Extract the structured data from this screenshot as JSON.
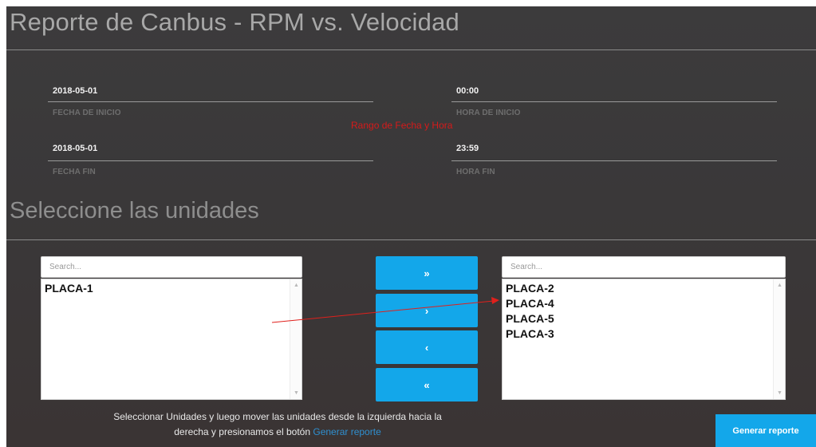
{
  "header": {
    "title": "Reporte de Canbus - RPM vs. Velocidad"
  },
  "date_range": {
    "start_date": {
      "value": "2018-05-01",
      "label": "FECHA DE INICIO"
    },
    "start_time": {
      "value": "00:00",
      "label": "HORA DE INICIO"
    },
    "end_date": {
      "value": "2018-05-01",
      "label": "FECHA FIN"
    },
    "end_time": {
      "value": "23:59",
      "label": "HORA FIN"
    },
    "annotation": "Rango de Fecha y Hora"
  },
  "units": {
    "title": "Seleccione las unidades",
    "available": {
      "search_placeholder": "Search...",
      "items": [
        "PLACA-1"
      ]
    },
    "selected": {
      "search_placeholder": "Search...",
      "items": [
        "PLACA-2",
        "PLACA-4",
        "PLACA-5",
        "PLACA-3"
      ]
    },
    "transfer_buttons": {
      "move_all_right": "»",
      "move_right": "›",
      "move_left": "‹",
      "move_all_left": "«"
    }
  },
  "hint": {
    "line1": "Seleccionar Unidades y luego mover las unidades desde la izquierda hacia la",
    "line2_prefix": "derecha y presionamos el botón",
    "line2_link": "Generar reporte"
  },
  "actions": {
    "generate_label": "Generar reporte"
  },
  "colors": {
    "accent": "#13a7ea",
    "annotation": "#d51a1a",
    "background": "#3a3839"
  }
}
